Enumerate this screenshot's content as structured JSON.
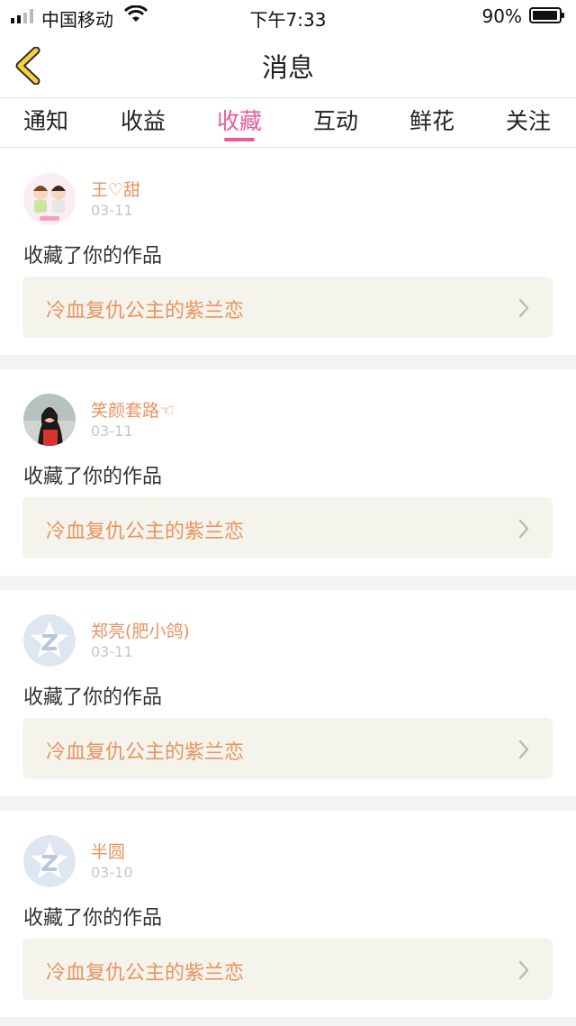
{
  "status_bar": {
    "carrier": "中国移动",
    "time": "下午7:33",
    "battery": "90%"
  },
  "nav": {
    "title": "消息"
  },
  "tabs": [
    {
      "label": "通知"
    },
    {
      "label": "收益"
    },
    {
      "label": "收藏"
    },
    {
      "label": "互动"
    },
    {
      "label": "鲜花"
    },
    {
      "label": "关注"
    }
  ],
  "active_tab": "收藏",
  "colors": {
    "accent_pink": "#e85c9a",
    "name_orange": "#e9935f",
    "work_box_bg": "#f4f4ec"
  },
  "messages": [
    {
      "name": "王♡甜",
      "date": "03-11",
      "action": "收藏了你的作品",
      "work": "冷血复仇公主的紫兰恋",
      "avatar": "cartoon-couple-avatar"
    },
    {
      "name": "笑颜套路☜",
      "date": "03-11",
      "action": "收藏了你的作品",
      "work": "冷血复仇公主的紫兰恋",
      "avatar": "photo-avatar"
    },
    {
      "name": "郑亮(肥小鸽)",
      "date": "03-11",
      "action": "收藏了你的作品",
      "work": "冷血复仇公主的紫兰恋",
      "avatar": "default-z-avatar"
    },
    {
      "name": "半圆",
      "date": "03-10",
      "action": "收藏了你的作品",
      "work": "冷血复仇公主的紫兰恋",
      "avatar": "default-z-avatar"
    }
  ]
}
